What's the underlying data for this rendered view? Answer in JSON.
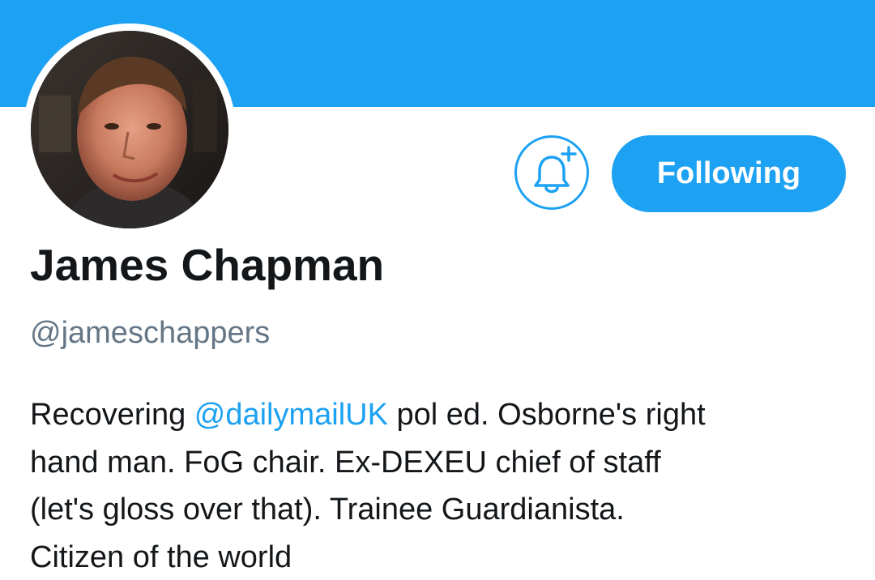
{
  "profile": {
    "display_name": "James Chapman",
    "handle": "@jameschappers",
    "bio": {
      "line1_before": "Recovering ",
      "line1_mention": "@dailymailUK",
      "line1_after": " pol ed. Osborne's right",
      "line2": "hand man. FoG chair. Ex-DEXEU chief of staff",
      "line3": "(let's gloss over that). Trainee Guardianista.",
      "line4": "Citizen of the world"
    }
  },
  "actions": {
    "notify_icon": "bell-plus-icon",
    "follow_label": "Following"
  },
  "colors": {
    "brand_blue": "#1da1f2",
    "text_primary": "#14171a",
    "text_secondary": "#657786"
  }
}
